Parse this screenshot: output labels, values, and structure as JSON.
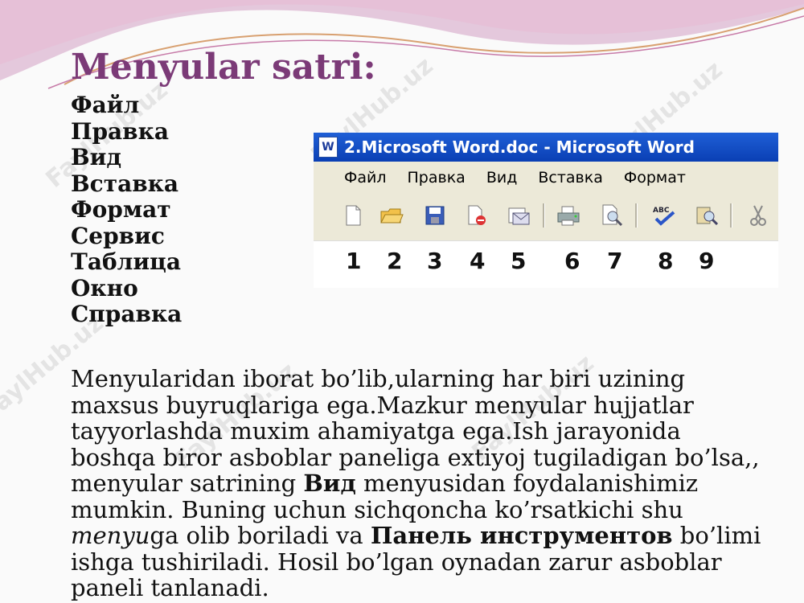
{
  "slide": {
    "title": "Menyular satri:",
    "menu_items": [
      "Файл",
      "Правка",
      "Вид",
      "Вставка",
      "Формат",
      "Сервис",
      "Таблица",
      "Окно",
      "Справка"
    ],
    "watermark": "FaylHub.uz"
  },
  "word_window": {
    "title": "2.Microsoft Word.doc - Microsoft Word",
    "menus": [
      "Файл",
      "Правка",
      "Вид",
      "Вставка",
      "Формат"
    ],
    "toolbar_icons": [
      "new-document-icon",
      "open-folder-icon",
      "save-icon",
      "permission-icon",
      "email-icon",
      "print-icon",
      "print-preview-icon",
      "spelling-check-icon",
      "research-icon",
      "cut-icon"
    ],
    "numbers": [
      "1",
      "2",
      "3",
      "4",
      "5",
      "6",
      "7",
      "8",
      "9"
    ]
  },
  "paragraph": {
    "part1": "Menyularidan iborat bo’lib,ularning har biri uzining maxsus buyruqlariga ega.Mazkur menyular hujjatlar tayyorlashda muxim ahamiyatga ega.Ish jarayonida boshqa biror asboblar paneliga extiyoj tugiladigan bo’lsa,, menyular satrining ",
    "bold1": "Вид",
    "part2": " menyusidan foydalanishimiz mumkin. Buning uchun sichqoncha ko’rsatkichi shu ",
    "italic1": "menyu",
    "part3": "ga olib boriladi va ",
    "bold2": "Панель инструментов",
    "part4": " bo’limi ishga tushiriladi. Hosil bo’lgan oynadan zarur asboblar paneli tanlanadi."
  }
}
